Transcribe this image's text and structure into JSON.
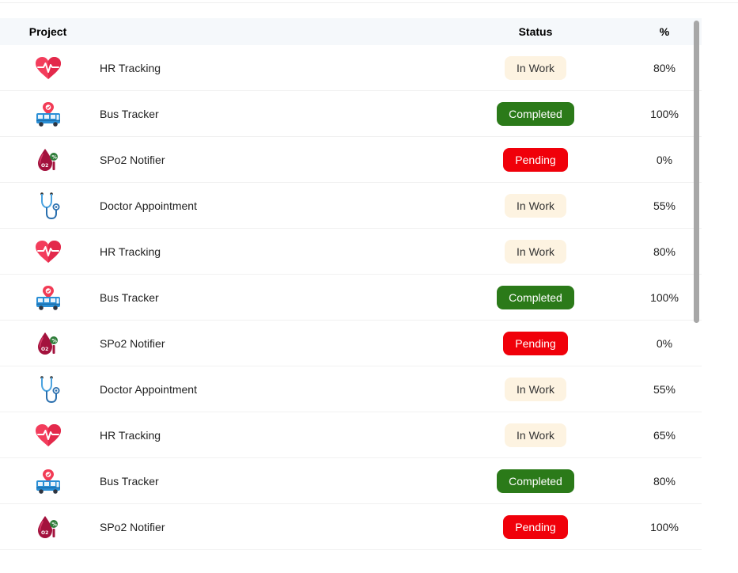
{
  "header": {
    "project_label": "Project",
    "status_label": "Status",
    "percent_label": "%"
  },
  "status_colors": {
    "In Work": "#fdf3e1",
    "Completed": "#2b7a19",
    "Pending": "#f0000a"
  },
  "rows": [
    {
      "icon": "heart-rate-icon",
      "name": "HR Tracking",
      "status": "In Work",
      "percent": "80%"
    },
    {
      "icon": "bus-tracker-icon",
      "name": "Bus Tracker",
      "status": "Completed",
      "percent": "100%"
    },
    {
      "icon": "spo2-drop-icon",
      "name": "SPo2 Notifier",
      "status": "Pending",
      "percent": "0%"
    },
    {
      "icon": "stethoscope-icon",
      "name": "Doctor Appointment",
      "status": "In Work",
      "percent": "55%"
    },
    {
      "icon": "heart-rate-icon",
      "name": "HR Tracking",
      "status": "In Work",
      "percent": "80%"
    },
    {
      "icon": "bus-tracker-icon",
      "name": "Bus Tracker",
      "status": "Completed",
      "percent": "100%"
    },
    {
      "icon": "spo2-drop-icon",
      "name": "SPo2 Notifier",
      "status": "Pending",
      "percent": "0%"
    },
    {
      "icon": "stethoscope-icon",
      "name": "Doctor Appointment",
      "status": "In Work",
      "percent": "55%"
    },
    {
      "icon": "heart-rate-icon",
      "name": "HR Tracking",
      "status": "In Work",
      "percent": "65%"
    },
    {
      "icon": "bus-tracker-icon",
      "name": "Bus Tracker",
      "status": "Completed",
      "percent": "80%"
    },
    {
      "icon": "spo2-drop-icon",
      "name": "SPo2 Notifier",
      "status": "Pending",
      "percent": "100%"
    }
  ]
}
